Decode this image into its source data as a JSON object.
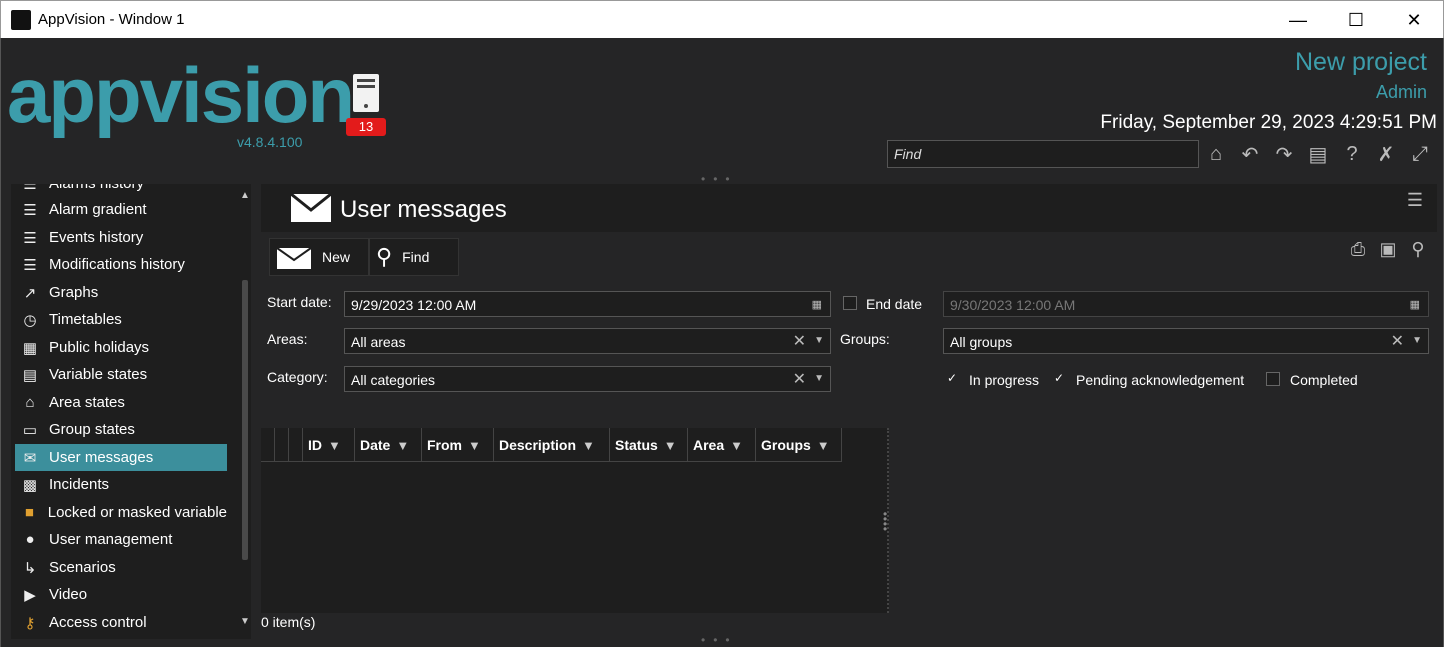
{
  "window": {
    "title": "AppVision - Window 1"
  },
  "header": {
    "logo": "appvision",
    "version": "v4.8.4.100",
    "server_badge": "13",
    "project": "New project",
    "user": "Admin",
    "datetime": "Friday, September 29, 2023 4:29:51 PM",
    "find_placeholder": "Find",
    "icons": [
      "home-icon",
      "undo-icon",
      "redo-icon",
      "add-panel-icon",
      "help-icon",
      "tools-icon",
      "fullscreen-icon"
    ]
  },
  "sidebar": {
    "items": [
      {
        "label": "Alarms history",
        "icon": "list-icon"
      },
      {
        "label": "Alarm gradient",
        "icon": "list-icon"
      },
      {
        "label": "Events history",
        "icon": "list-icon"
      },
      {
        "label": "Modifications history",
        "icon": "list-icon"
      },
      {
        "label": "Graphs",
        "icon": "graph-icon"
      },
      {
        "label": "Timetables",
        "icon": "clock-icon"
      },
      {
        "label": "Public holidays",
        "icon": "calendar-icon"
      },
      {
        "label": "Variable states",
        "icon": "table-icon"
      },
      {
        "label": "Area states",
        "icon": "house-icon"
      },
      {
        "label": "Group states",
        "icon": "folder-icon"
      },
      {
        "label": "User messages",
        "icon": "envelope-icon",
        "selected": true
      },
      {
        "label": "Incidents",
        "icon": "incident-icon"
      },
      {
        "label": "Locked or masked variable",
        "icon": "lock-icon"
      },
      {
        "label": "User management",
        "icon": "users-icon"
      },
      {
        "label": "Scenarios",
        "icon": "scenario-icon"
      },
      {
        "label": "Video",
        "icon": "video-icon"
      },
      {
        "label": "Access control",
        "icon": "key-icon"
      }
    ]
  },
  "panel": {
    "title": "User messages",
    "toolbar": {
      "new_label": "New",
      "find_label": "Find"
    },
    "start_date_label": "Start date:",
    "start_date_value": "9/29/2023 12:00 AM",
    "end_date_label": "End date",
    "end_date_value": "9/30/2023 12:00 AM",
    "areas_label": "Areas:",
    "areas_value": "All areas",
    "groups_label": "Groups:",
    "groups_value": "All groups",
    "category_label": "Category:",
    "category_value": "All categories",
    "in_progress_label": "In progress",
    "pending_label": "Pending acknowledgement",
    "completed_label": "Completed",
    "columns": [
      "ID",
      "Date",
      "From",
      "Description",
      "Status",
      "Area",
      "Groups"
    ],
    "item_count": "0 item(s)"
  },
  "colors": {
    "accent": "#3c9dab",
    "selection": "#3c8f9c",
    "badge": "#e31b1b"
  }
}
